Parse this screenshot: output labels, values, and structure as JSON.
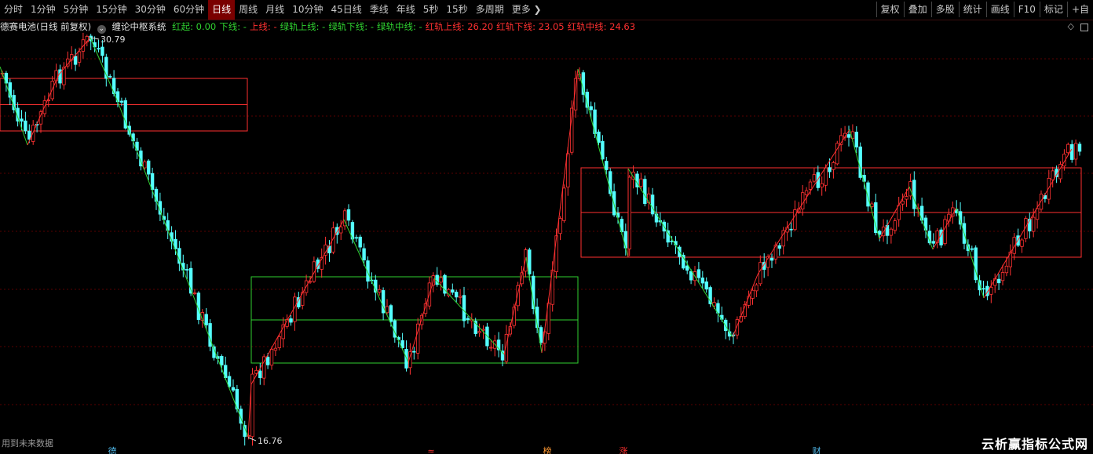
{
  "toolbar": {
    "period_tabs": [
      "分时",
      "1分钟",
      "5分钟",
      "15分钟",
      "30分钟",
      "60分钟",
      "日线",
      "周线",
      "月线",
      "10分钟",
      "45日线",
      "季线",
      "年线",
      "5秒",
      "15秒",
      "多周期",
      "更多"
    ],
    "active_tab": "日线",
    "right_tools": [
      "复权",
      "叠加",
      "多股",
      "统计",
      "画线",
      "F10",
      "标记",
      "+自"
    ]
  },
  "info_bar": {
    "stock_name": "德赛电池",
    "period_mode": "(日线 前复权)",
    "indicator_name": "缠论中枢系统",
    "items": [
      {
        "label": "红起: 0.00",
        "color": "#30d030"
      },
      {
        "label": "下线: -",
        "color": "#30d030"
      },
      {
        "label": "上线: -",
        "color": "#ff3030"
      },
      {
        "label": "绿轨上线: -",
        "color": "#30d030"
      },
      {
        "label": "绿轨下线: -",
        "color": "#30d030"
      },
      {
        "label": "绿轨中线: -",
        "color": "#30d030"
      },
      {
        "label": "红轨上线: 26.20",
        "color": "#ff3030"
      },
      {
        "label": "红轨下线: 23.05",
        "color": "#ff3030"
      },
      {
        "label": "红轨中线: 24.63",
        "color": "#ff3030"
      }
    ]
  },
  "price_labels": {
    "high": "30.79",
    "low": "16.76"
  },
  "event_markers": [
    {
      "text": "德",
      "color": "#4fb7e8"
    },
    {
      "text": "≈",
      "color": "#ff3030"
    },
    {
      "text": "榜",
      "color": "#ff9933"
    },
    {
      "text": "涨",
      "color": "#ff3030"
    },
    {
      "text": "财",
      "color": "#4fb7e8"
    }
  ],
  "bottom_label": "用到未来数据",
  "watermark": "云析赢指标公式网",
  "colors": {
    "up": "#ff3232",
    "down": "#54ffff",
    "green_line": "#30d030",
    "red_line": "#ff3030",
    "grid": "#5a0000"
  }
}
